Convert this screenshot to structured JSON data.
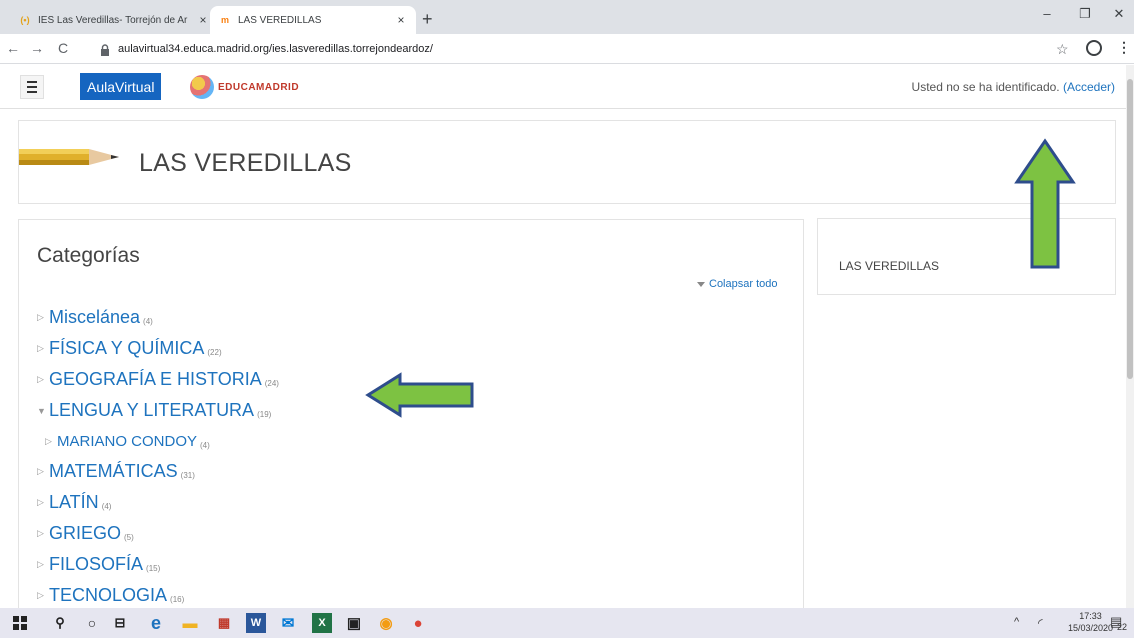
{
  "browser": {
    "tabs": [
      {
        "title": "IES Las Veredillas- Torrejón de Ar",
        "favicon": "globe-favicon",
        "active": false,
        "close": "×"
      },
      {
        "title": "LAS VEREDILLAS",
        "favicon": "moodle-favicon",
        "active": true,
        "close": "×"
      }
    ],
    "new_tab": "+",
    "url": "aulavirtual34.educa.madrid.org/ies.lasveredillas.torrejondeardoz/",
    "window_controls": {
      "minimize": "–",
      "restore": "❐",
      "close": "✕"
    }
  },
  "navbar": {
    "brand": "AulaVirtual",
    "partner_logo_text": "EDUCAMADRID",
    "user_status": "Usted no se ha identificado.",
    "login_link": "(Acceder)"
  },
  "header": {
    "site_title": "LAS VEREDILLAS"
  },
  "categories": {
    "heading": "Categorías",
    "collapse_all": "Colapsar todo",
    "items": [
      {
        "name": "Miscelánea",
        "count": "(4)",
        "expanded": false,
        "level": 0
      },
      {
        "name": "FÍSICA Y QUÍMICA",
        "count": "(22)",
        "expanded": false,
        "level": 0
      },
      {
        "name": "GEOGRAFÍA E HISTORIA",
        "count": "(24)",
        "expanded": false,
        "level": 0
      },
      {
        "name": "LENGUA Y LITERATURA",
        "count": "(19)",
        "expanded": true,
        "level": 0
      },
      {
        "name": "MARIANO CONDOY",
        "count": "(4)",
        "expanded": false,
        "level": 1
      },
      {
        "name": "MATEMÁTICAS",
        "count": "(31)",
        "expanded": false,
        "level": 0
      },
      {
        "name": "LATÍN",
        "count": "(4)",
        "expanded": false,
        "level": 0
      },
      {
        "name": "GRIEGO",
        "count": "(5)",
        "expanded": false,
        "level": 0
      },
      {
        "name": "FILOSOFÍA",
        "count": "(15)",
        "expanded": false,
        "level": 0
      },
      {
        "name": "TECNOLOGIA",
        "count": "(16)",
        "expanded": false,
        "level": 0
      }
    ]
  },
  "side_block": {
    "text": "LAS VEREDILLAS"
  },
  "taskbar": {
    "time": "17:33",
    "date": "15/03/2020",
    "notifications": "22",
    "icons": [
      "windows-start-icon",
      "search-icon",
      "cortana-icon",
      "task-view-icon",
      "edge-icon",
      "file-explorer-icon",
      "gift-icon",
      "word-icon",
      "mail-icon",
      "excel-icon",
      "store-icon",
      "app-icon",
      "chrome-icon"
    ]
  },
  "colors": {
    "accent": "#1565c0",
    "link": "#1e73be",
    "annotation_arrow": "#7dc242"
  }
}
